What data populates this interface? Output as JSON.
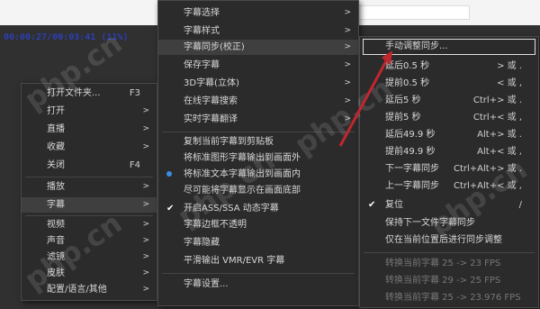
{
  "osd_time": "00:00:27/00:03:41 (11%)",
  "watermark": "php.cn",
  "menu1": [
    {
      "label": "打开文件夹...",
      "shortcut": "F3",
      "arrow": ""
    },
    {
      "label": "打开",
      "shortcut": "",
      "arrow": ">"
    },
    {
      "label": "直播",
      "shortcut": "",
      "arrow": ">"
    },
    {
      "label": "收藏",
      "shortcut": "",
      "arrow": ">"
    },
    {
      "label": "关闭",
      "shortcut": "F4",
      "arrow": ""
    },
    {
      "label": "播放",
      "shortcut": "",
      "arrow": ">"
    },
    {
      "label": "字幕",
      "shortcut": "",
      "arrow": ">"
    },
    {
      "label": "视频",
      "shortcut": "",
      "arrow": ">"
    },
    {
      "label": "声音",
      "shortcut": "",
      "arrow": ">"
    },
    {
      "label": "滤镜",
      "shortcut": "",
      "arrow": ">"
    },
    {
      "label": "皮肤",
      "shortcut": "",
      "arrow": ">"
    },
    {
      "label": "配置/语言/其他",
      "shortcut": "",
      "arrow": ">"
    }
  ],
  "menu2": [
    {
      "label": "字幕选择",
      "arrow": ">"
    },
    {
      "label": "字幕样式",
      "arrow": ">"
    },
    {
      "label": "字幕同步(校正)",
      "arrow": ">"
    },
    {
      "label": "保存字幕",
      "arrow": ">"
    },
    {
      "label": "3D字幕(立体)",
      "arrow": ">"
    },
    {
      "label": "在线字幕搜索",
      "arrow": ">"
    },
    {
      "label": "实时字幕翻译",
      "arrow": ">"
    },
    {
      "label": "复制当前字幕到剪贴板",
      "arrow": ""
    },
    {
      "label": "将标准图形字幕输出到画面外",
      "arrow": ""
    },
    {
      "label": "将标准文本字幕输出到画面内",
      "arrow": ""
    },
    {
      "label": "尽可能将字幕显示在画面底部",
      "arrow": ""
    },
    {
      "label": "开启ASS/SSA 动态字幕",
      "arrow": ""
    },
    {
      "label": "字幕边框不透明",
      "arrow": ""
    },
    {
      "label": "字幕隐藏",
      "arrow": ""
    },
    {
      "label": "平滑输出 VMR/EVR 字幕",
      "arrow": ""
    },
    {
      "label": "字幕设置...",
      "arrow": ""
    }
  ],
  "menu3": [
    {
      "label": "手动调整同步...",
      "shortcut": ""
    },
    {
      "label": "延后0.5 秒",
      "shortcut": "> 或 ."
    },
    {
      "label": "提前0.5 秒",
      "shortcut": "< 或 ,"
    },
    {
      "label": "延后5 秒",
      "shortcut": "Ctrl+> 或 ."
    },
    {
      "label": "提前5 秒",
      "shortcut": "Ctrl+< 或 ,"
    },
    {
      "label": "延后49.9 秒",
      "shortcut": "Alt+> 或 ."
    },
    {
      "label": "提前49.9 秒",
      "shortcut": "Alt+< 或 ,"
    },
    {
      "label": "下一字幕同步",
      "shortcut": "Ctrl+Alt+> 或 ."
    },
    {
      "label": "上一字幕同步",
      "shortcut": "Ctrl+Alt+< 或 ,"
    },
    {
      "label": "复位",
      "shortcut": "/"
    },
    {
      "label": "保持下一文件字幕同步",
      "shortcut": ""
    },
    {
      "label": "仅在当前位置后进行同步调整",
      "shortcut": ""
    },
    {
      "label": "转换当前字幕 25 -> 23 FPS",
      "shortcut": ""
    },
    {
      "label": "转换当前字幕 29 -> 25 FPS",
      "shortcut": ""
    },
    {
      "label": "转换当前字幕 25 -> 23.976 FPS",
      "shortcut": ""
    }
  ],
  "colors": {
    "arrow": "#c0272d",
    "radio": "#3a8ee6",
    "osd": "#2b3fb8"
  }
}
